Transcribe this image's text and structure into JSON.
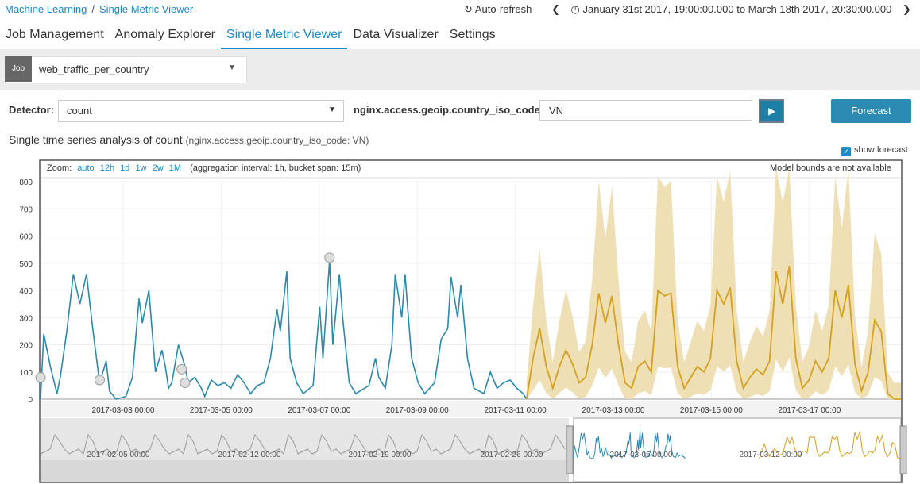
{
  "breadcrumb": {
    "root": "Machine Learning",
    "current": "Single Metric Viewer"
  },
  "header": {
    "auto_refresh": "Auto-refresh",
    "time_range": "January 31st 2017, 19:00:00.000 to March 18th 2017, 20:30:00.000"
  },
  "tabs": [
    {
      "label": "Job Management"
    },
    {
      "label": "Anomaly Explorer"
    },
    {
      "label": "Single Metric Viewer",
      "active": true
    },
    {
      "label": "Data Visualizer"
    },
    {
      "label": "Settings"
    }
  ],
  "job": {
    "label": "Job",
    "value": "web_traffic_per_country"
  },
  "detector": {
    "label": "Detector:",
    "value": "count"
  },
  "entity": {
    "label": "nginx.access.geoip.country_iso_code:",
    "value": "VN"
  },
  "forecast_button": "Forecast",
  "chart_title": {
    "main": "Single time series analysis of count",
    "sub": "(nginx.access.geoip.country_iso_code: VN)"
  },
  "show_forecast": {
    "label": "show forecast",
    "checked": true
  },
  "zoom": {
    "label": "Zoom:",
    "options": [
      "auto",
      "12h",
      "1d",
      "1w",
      "2w",
      "1M"
    ],
    "aggregation": "(aggregation interval: 1h, bucket span: 15m)"
  },
  "model_bounds_note": "Model bounds are not available",
  "colors": {
    "actual": "#2a8aab",
    "forecast": "#d3a11f",
    "forecast_bounds": "#efdfb4",
    "accent": "#1b8ac8"
  },
  "chart_data": {
    "type": "line",
    "ylim": [
      0,
      800
    ],
    "yticks": [
      0,
      100,
      200,
      300,
      400,
      500,
      600,
      700,
      800
    ],
    "xticks": [
      "2017-03-03 00:00",
      "2017-03-05 00:00",
      "2017-03-07 00:00",
      "2017-03-09 00:00",
      "2017-03-11 00:00",
      "2017-03-13 00:00",
      "2017-03-15 00:00",
      "2017-03-17 00:00"
    ],
    "x_range_days": [
      0,
      17.7
    ],
    "series": [
      {
        "name": "actual",
        "points": [
          [
            0,
            0
          ],
          [
            0.1,
            240
          ],
          [
            0.3,
            120
          ],
          [
            0.5,
            20
          ],
          [
            0.6,
            80
          ],
          [
            0.8,
            250
          ],
          [
            1.0,
            460
          ],
          [
            1.2,
            350
          ],
          [
            1.4,
            460
          ],
          [
            1.6,
            250
          ],
          [
            1.8,
            60
          ],
          [
            2.0,
            140
          ],
          [
            2.1,
            30
          ],
          [
            2.3,
            0
          ],
          [
            2.6,
            10
          ],
          [
            2.8,
            80
          ],
          [
            3.0,
            370
          ],
          [
            3.1,
            280
          ],
          [
            3.3,
            400
          ],
          [
            3.4,
            250
          ],
          [
            3.5,
            100
          ],
          [
            3.7,
            180
          ],
          [
            3.8,
            120
          ],
          [
            3.9,
            40
          ],
          [
            4.0,
            60
          ],
          [
            4.2,
            200
          ],
          [
            4.4,
            120
          ],
          [
            4.5,
            60
          ],
          [
            4.7,
            80
          ],
          [
            4.9,
            40
          ],
          [
            5.0,
            10
          ],
          [
            5.2,
            70
          ],
          [
            5.4,
            50
          ],
          [
            5.6,
            60
          ],
          [
            5.8,
            40
          ],
          [
            6.0,
            90
          ],
          [
            6.2,
            60
          ],
          [
            6.4,
            20
          ],
          [
            6.6,
            50
          ],
          [
            6.8,
            60
          ],
          [
            7.0,
            150
          ],
          [
            7.2,
            330
          ],
          [
            7.3,
            250
          ],
          [
            7.5,
            470
          ],
          [
            7.6,
            150
          ],
          [
            7.8,
            60
          ],
          [
            8.0,
            20
          ],
          [
            8.3,
            50
          ],
          [
            8.5,
            340
          ],
          [
            8.6,
            150
          ],
          [
            8.8,
            510
          ],
          [
            8.9,
            200
          ],
          [
            9.1,
            460
          ],
          [
            9.2,
            300
          ],
          [
            9.4,
            60
          ],
          [
            9.6,
            20
          ],
          [
            10.0,
            50
          ],
          [
            10.2,
            150
          ],
          [
            10.3,
            80
          ],
          [
            10.5,
            40
          ],
          [
            10.7,
            200
          ],
          [
            10.8,
            460
          ],
          [
            11.0,
            300
          ],
          [
            11.1,
            460
          ],
          [
            11.3,
            150
          ],
          [
            11.5,
            60
          ],
          [
            11.7,
            20
          ],
          [
            12.0,
            60
          ],
          [
            12.2,
            220
          ],
          [
            12.4,
            260
          ],
          [
            12.5,
            450
          ],
          [
            12.7,
            300
          ],
          [
            12.8,
            420
          ],
          [
            13.0,
            150
          ],
          [
            13.2,
            40
          ],
          [
            13.5,
            20
          ],
          [
            13.7,
            100
          ],
          [
            13.9,
            40
          ],
          [
            14.1,
            60
          ],
          [
            14.3,
            70
          ],
          [
            14.5,
            40
          ],
          [
            14.7,
            20
          ],
          [
            14.8,
            0
          ]
        ]
      },
      {
        "name": "forecast",
        "points": [
          [
            14.8,
            0
          ],
          [
            15.0,
            150
          ],
          [
            15.2,
            260
          ],
          [
            15.4,
            120
          ],
          [
            15.6,
            40
          ],
          [
            15.8,
            120
          ],
          [
            16.0,
            180
          ],
          [
            16.2,
            130
          ],
          [
            16.4,
            60
          ],
          [
            16.6,
            80
          ],
          [
            16.8,
            200
          ],
          [
            17.0,
            390
          ],
          [
            17.2,
            280
          ],
          [
            17.4,
            380
          ],
          [
            17.6,
            200
          ]
        ]
      },
      {
        "name": "forecast_extra",
        "points": [
          [
            17.6,
            200
          ],
          [
            17.8,
            60
          ],
          [
            18.0,
            40
          ],
          [
            18.2,
            120
          ],
          [
            18.4,
            140
          ],
          [
            18.6,
            100
          ],
          [
            18.8,
            400
          ],
          [
            19.0,
            380
          ],
          [
            19.2,
            390
          ],
          [
            19.4,
            120
          ],
          [
            19.6,
            40
          ],
          [
            19.8,
            80
          ],
          [
            20.0,
            120
          ],
          [
            20.2,
            100
          ],
          [
            20.4,
            150
          ],
          [
            20.6,
            400
          ],
          [
            20.8,
            350
          ],
          [
            21.0,
            410
          ],
          [
            21.2,
            140
          ],
          [
            21.4,
            40
          ],
          [
            21.6,
            80
          ],
          [
            21.8,
            110
          ],
          [
            22.0,
            90
          ],
          [
            22.2,
            140
          ],
          [
            22.4,
            470
          ],
          [
            22.6,
            350
          ],
          [
            22.8,
            490
          ],
          [
            23.0,
            150
          ],
          [
            23.2,
            40
          ],
          [
            23.4,
            70
          ],
          [
            23.6,
            140
          ],
          [
            23.8,
            100
          ],
          [
            24.0,
            150
          ],
          [
            24.2,
            400
          ],
          [
            24.4,
            300
          ],
          [
            24.6,
            420
          ],
          [
            24.8,
            130
          ],
          [
            25.0,
            30
          ],
          [
            25.2,
            100
          ],
          [
            25.4,
            290
          ],
          [
            25.6,
            250
          ],
          [
            25.8,
            20
          ],
          [
            26.0,
            0
          ],
          [
            26.2,
            0
          ]
        ]
      }
    ],
    "anomalies": [
      [
        0.0,
        80
      ],
      [
        1.8,
        70
      ],
      [
        4.3,
        110
      ],
      [
        4.4,
        60
      ],
      [
        8.8,
        520
      ]
    ]
  }
}
